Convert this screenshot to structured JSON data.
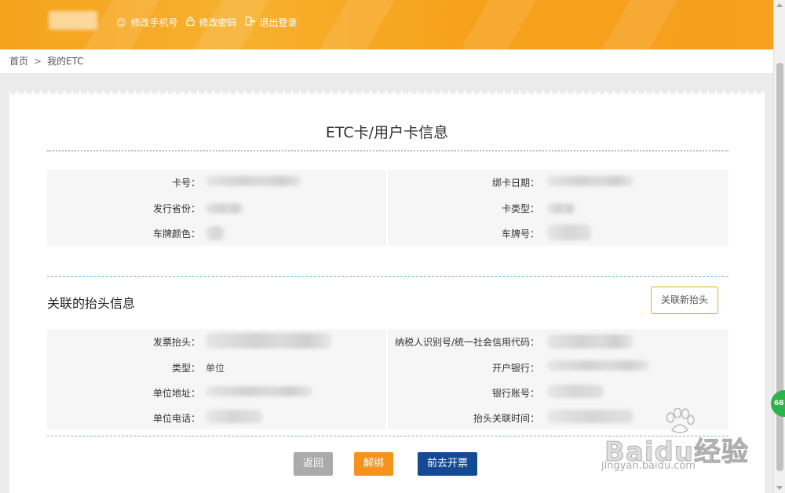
{
  "header": {
    "links": [
      {
        "label": "修改手机号",
        "icon": "user-circle-icon",
        "glyph": "☺"
      },
      {
        "label": "修改密码",
        "icon": "lock-icon",
        "glyph": "🔒"
      },
      {
        "label": "退出登录",
        "icon": "logout-icon",
        "glyph": "⇥"
      }
    ]
  },
  "breadcrumb": {
    "home": "首页",
    "separator": ">",
    "current": "我的ETC"
  },
  "card_info": {
    "title": "ETC卡/用户卡信息",
    "left_labels": [
      "卡号：",
      "发行省份：",
      "车牌颜色："
    ],
    "right_labels": [
      "绑卡日期：",
      "卡类型：",
      "车牌号："
    ]
  },
  "invoice_header": {
    "title": "关联的抬头信息",
    "add_button": "关联新抬头",
    "left_labels": [
      "发票抬头：",
      "类型：",
      "单位地址：",
      "单位电话："
    ],
    "type_value": "单位",
    "right_labels": [
      "纳税人识别号/统一社会信用代码：",
      "开户银行：",
      "银行账号：",
      "抬头关联时间："
    ]
  },
  "actions": {
    "back": "返回",
    "unbind": "解绑",
    "invoice": "前去开票"
  },
  "badge": {
    "text": "68"
  },
  "watermark": {
    "brand": "Baidu经验",
    "url": "jingyan.baidu.com"
  },
  "colors": {
    "header": "#f5a21c",
    "unbind": "#f6921e",
    "invoice": "#134a93",
    "back": "#aaaaaa",
    "divider": "#7bb4da"
  }
}
